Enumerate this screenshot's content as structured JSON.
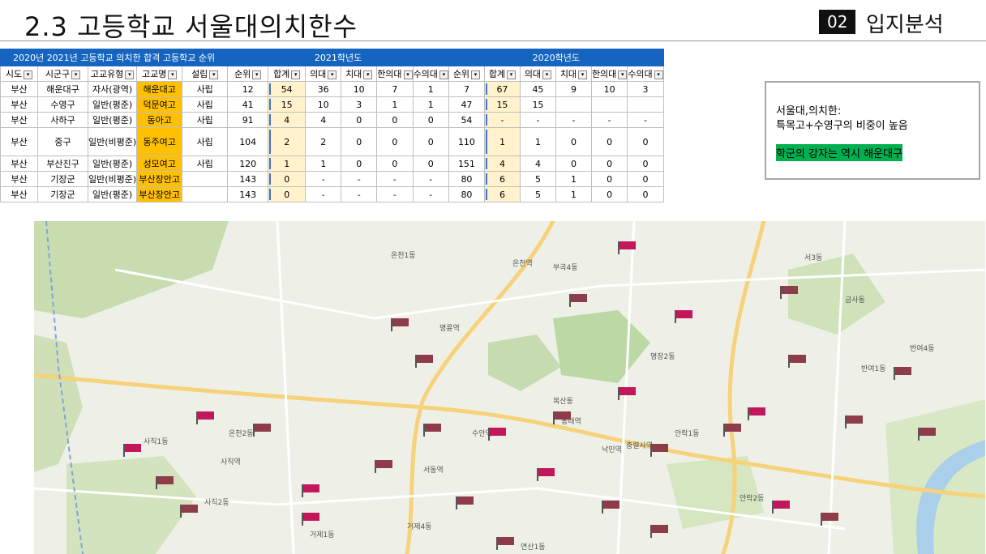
{
  "title": "2.3 고등학교 서울대의치한수",
  "badge": "02",
  "section": "입지분석",
  "table": {
    "caption": "2020년 2021년 고등학교 의치한 합격 고등학교 순위",
    "year2021": "2021학년도",
    "year2020": "2020학년도",
    "headers": [
      "시도",
      "시군구",
      "고교유형",
      "고교명",
      "설립",
      "순위",
      "합계",
      "의대",
      "치대",
      "한의대",
      "수의대",
      "순위",
      "합계",
      "의대",
      "치대",
      "한의대",
      "수의대"
    ],
    "rows": [
      [
        "부산",
        "해운대구",
        "자사(광역)",
        "해운대고",
        "사립",
        "12",
        "54",
        "36",
        "10",
        "7",
        "1",
        "7",
        "67",
        "45",
        "9",
        "10",
        "3"
      ],
      [
        "부산",
        "수영구",
        "일반(평준)",
        "덕문여고",
        "사립",
        "41",
        "15",
        "10",
        "3",
        "1",
        "1",
        "47",
        "15",
        "15",
        "",
        "",
        ""
      ],
      [
        "부산",
        "사하구",
        "일반(평준)",
        "동아고",
        "사립",
        "91",
        "4",
        "4",
        "0",
        "0",
        "0",
        "54",
        "-",
        "-",
        "-",
        "-",
        "-"
      ],
      [
        "부산",
        "중구",
        "일반(비평준)",
        "동주여고",
        "사립",
        "104",
        "2",
        "2",
        "0",
        "0",
        "0",
        "110",
        "1",
        "1",
        "0",
        "0",
        "0"
      ],
      [
        "부산",
        "부산진구",
        "일반(평준)",
        "성모여고",
        "사립",
        "120",
        "1",
        "1",
        "0",
        "0",
        "0",
        "151",
        "4",
        "4",
        "0",
        "0",
        "0"
      ],
      [
        "부산",
        "기장군",
        "일반(비평준)",
        "부산장안고",
        "",
        "143",
        "0",
        "-",
        "-",
        "-",
        "-",
        "80",
        "6",
        "5",
        "1",
        "0",
        "0"
      ],
      [
        "부산",
        "기장군",
        "일반(평준)",
        "부산장안고",
        "",
        "143",
        "0",
        "-",
        "-",
        "-",
        "-",
        "80",
        "6",
        "5",
        "1",
        "0",
        "0"
      ]
    ]
  },
  "note": {
    "line1": "서울대,의치한:",
    "line2": "특목고+수영구의 비중이 높음",
    "highlight": "학군의 강자는 역시 해운대구"
  },
  "map": {
    "labels": [
      "온천역",
      "부곡4동",
      "서3동",
      "명장2동",
      "반여1동",
      "온천1동",
      "복산동",
      "안락1동",
      "충렬사역",
      "사직1동",
      "사직역",
      "연산1동",
      "거제4동",
      "명륜역",
      "금사동",
      "서동역",
      "온천2동",
      "수안역",
      "동래역",
      "낙민역",
      "반여4동",
      "사직2동",
      "안락2동",
      "거제1동"
    ]
  },
  "colors": {
    "header": "#1565c0",
    "school": "#ffc000",
    "total": "#fff2cc",
    "highlight": "#00b050"
  }
}
